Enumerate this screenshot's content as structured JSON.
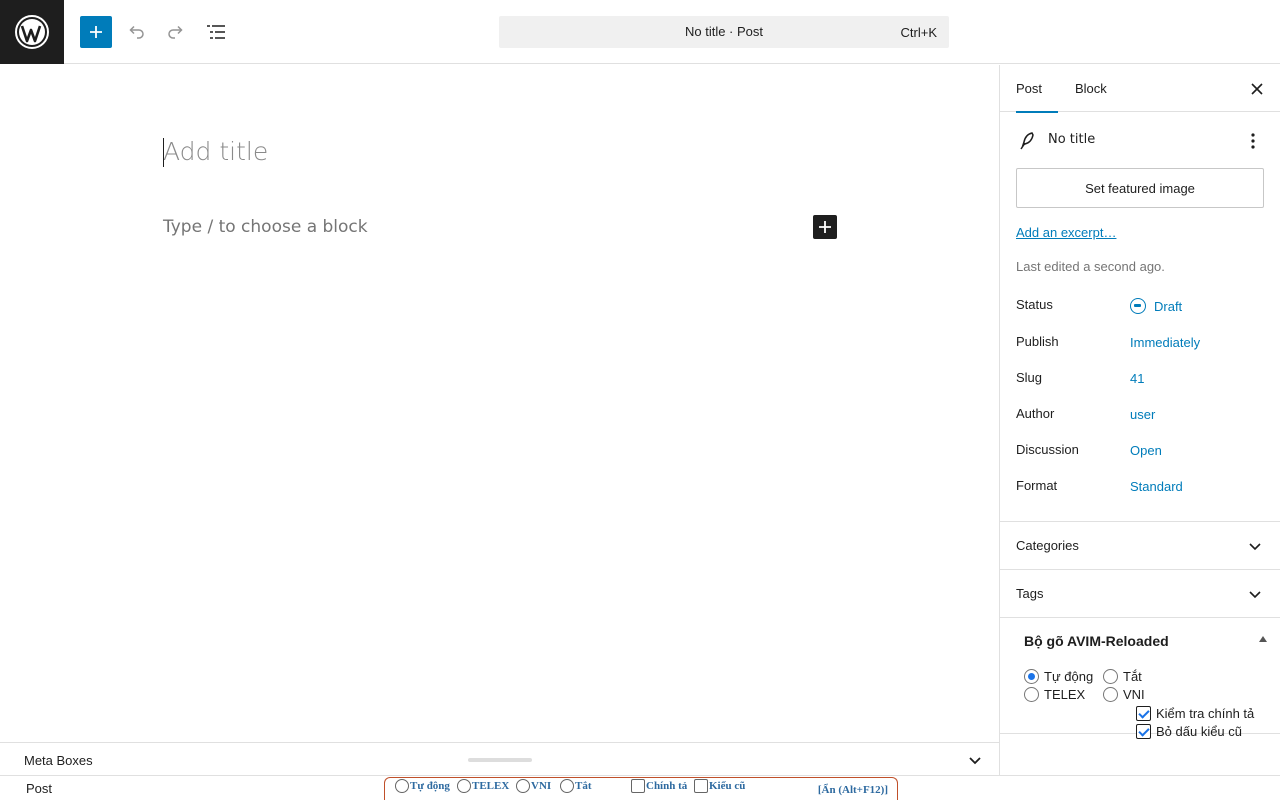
{
  "header": {
    "document_title": "No title · Post",
    "shortcut": "Ctrl+K",
    "icons": [
      "wordpress-logo-icon",
      "plus-icon",
      "undo-icon",
      "redo-icon",
      "list-view-icon"
    ]
  },
  "editor": {
    "title_placeholder": "Add title",
    "block_placeholder": "Type / to choose a block"
  },
  "metabox": {
    "label": "Meta Boxes"
  },
  "footer": {
    "breadcrumb": "Post"
  },
  "avim_bar": {
    "modes": [
      "Tự động",
      "TELEX",
      "VNI",
      "Tắt"
    ],
    "checks": [
      "Chính tả",
      "Kiểu cũ"
    ],
    "hide_label": "[Ẩn (Alt+F12)]"
  },
  "sidebar": {
    "tabs": [
      {
        "label": "Post",
        "active": true
      },
      {
        "label": "Block",
        "active": false
      }
    ],
    "post_title": "No title",
    "featured_button": "Set featured image",
    "excerpt_link": "Add an excerpt…",
    "last_edited": "Last edited a second ago.",
    "rows": [
      {
        "label": "Status",
        "value": "Draft"
      },
      {
        "label": "Publish",
        "value": "Immediately"
      },
      {
        "label": "Slug",
        "value": "41"
      },
      {
        "label": "Author",
        "value": "user"
      },
      {
        "label": "Discussion",
        "value": "Open"
      },
      {
        "label": "Format",
        "value": "Standard"
      }
    ],
    "panels": [
      "Categories",
      "Tags"
    ],
    "avim_panel": {
      "title": "Bộ gõ AVIM-Reloaded",
      "radios": [
        {
          "label": "Tự động",
          "checked": true
        },
        {
          "label": "Tắt",
          "checked": false
        },
        {
          "label": "TELEX",
          "checked": false
        },
        {
          "label": "VNI",
          "checked": false
        }
      ],
      "checkboxes": [
        {
          "label": "Kiểm tra chính tả",
          "checked": true
        },
        {
          "label": "Bỏ dấu kiểu cũ",
          "checked": true
        }
      ]
    }
  },
  "colors": {
    "accent": "#007cba",
    "dark": "#1e1e1e",
    "avim_border": "#c0502a",
    "avim_text": "#2e6aa0"
  }
}
